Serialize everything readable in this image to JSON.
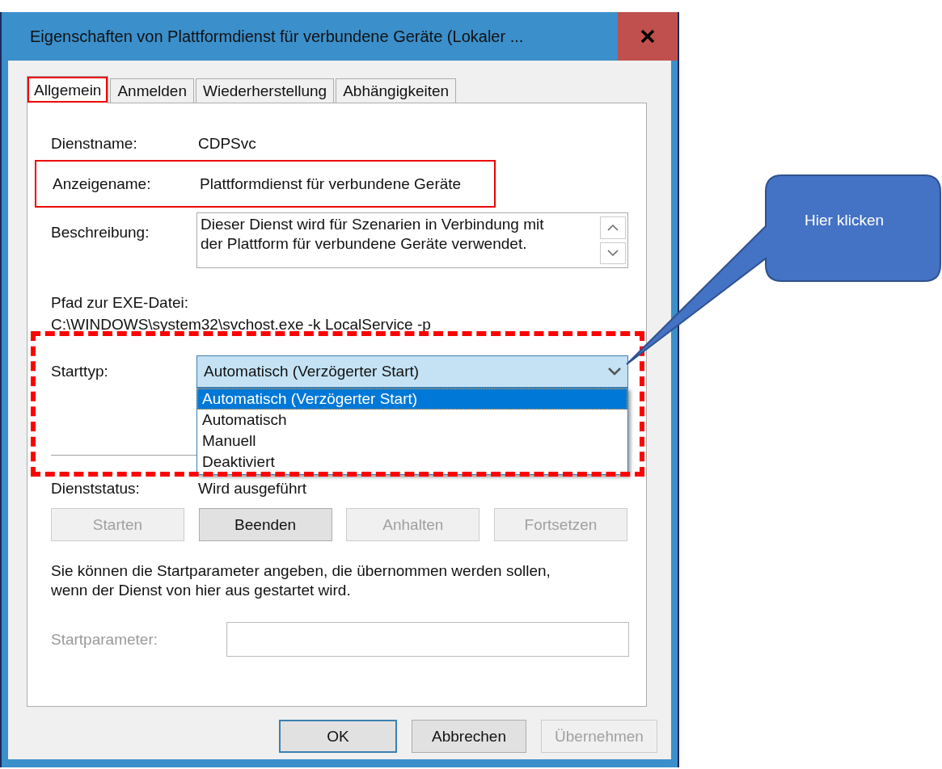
{
  "window": {
    "title": "Eigenschaften von Plattformdienst für verbundene Geräte (Lokaler ..."
  },
  "tabs": [
    {
      "label": "Allgemein",
      "selected": true,
      "highlighted": true
    },
    {
      "label": "Anmelden",
      "selected": false,
      "highlighted": false
    },
    {
      "label": "Wiederherstellung",
      "selected": false,
      "highlighted": false
    },
    {
      "label": "Abhängigkeiten",
      "selected": false,
      "highlighted": false
    }
  ],
  "fields": [
    {
      "label": "Dienstname:",
      "value": "CDPSvc",
      "highlighted": false
    },
    {
      "label": "Anzeigename:",
      "value": "Plattformdienst für verbundene Geräte",
      "highlighted": true
    }
  ],
  "description": {
    "label": "Beschreibung:",
    "text": "Dieser Dienst wird für Szenarien in Verbindung mit\nder Plattform für verbundene Geräte verwendet."
  },
  "exe_path": {
    "label": "Pfad zur EXE-Datei:",
    "value": "C:\\WINDOWS\\system32\\svchost.exe -k LocalService -p"
  },
  "start_type": {
    "label": "Starttyp:",
    "value": "Automatisch (Verzögerter Start)",
    "expanded": true,
    "options": [
      {
        "label": "Automatisch (Verzögerter Start)",
        "selected": true
      },
      {
        "label": "Automatisch",
        "selected": false
      },
      {
        "label": "Manuell",
        "selected": false
      },
      {
        "label": "Deaktiviert",
        "selected": false
      }
    ]
  },
  "service_status": {
    "label": "Dienststatus:",
    "value": "Wird ausgeführt"
  },
  "service_buttons": [
    {
      "label": "Starten",
      "disabled": true
    },
    {
      "label": "Beenden",
      "disabled": false
    },
    {
      "label": "Anhalten",
      "disabled": true
    },
    {
      "label": "Fortsetzen",
      "disabled": true
    }
  ],
  "hint": "Sie können die Startparameter angeben, die übernommen werden sollen,\nwenn der Dienst von hier aus gestartet wird.",
  "start_params": {
    "label": "Startparameter:",
    "disabled": true
  },
  "dialog_buttons": [
    {
      "label": "OK",
      "disabled": false,
      "default": true
    },
    {
      "label": "Abbrechen",
      "disabled": false,
      "default": false
    },
    {
      "label": "Übernehmen",
      "disabled": true,
      "default": false
    }
  ],
  "callout": {
    "text": "Hier klicken"
  }
}
